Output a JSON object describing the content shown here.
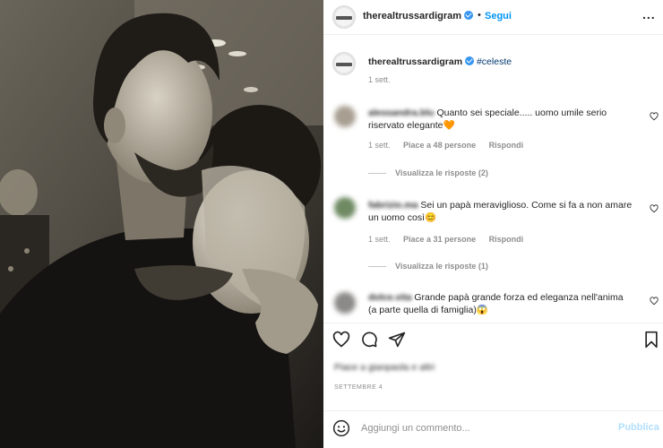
{
  "post": {
    "username": "therealtrussardigram",
    "follow_label": "Segui",
    "dot": "•",
    "more_label": "...",
    "caption_hashtag": "#celeste",
    "caption_time": "1 sett."
  },
  "comments": [
    {
      "username": "alessandra.blu",
      "text_line1": "Quanto sei speciale..... uomo umile serio",
      "text_line2": "riservato elegante",
      "emoji": "🧡",
      "time": "1 sett.",
      "likes": "Piace a 48 persone",
      "reply_label": "Rispondi",
      "view_replies": "Visualizza le risposte (2)"
    },
    {
      "username": "fabrizio.ma",
      "text_line1": "Sei un papà meraviglioso. Come si fa a non amare",
      "text_line2": "un uomo così",
      "emoji": "😊",
      "time": "1 sett.",
      "likes": "Piace a 31 persone",
      "reply_label": "Rispondi",
      "view_replies": "Visualizza le risposte (1)"
    },
    {
      "username": "dolce.vita",
      "text_line1": "Grande papà grande forza ed eleganza nell'anima",
      "text_line2": "(a parte quella di famiglia)",
      "emoji": "😱"
    }
  ],
  "likes_summary": "Piace a gianpaola e altri",
  "post_date": "Settembre 4",
  "add_comment": {
    "placeholder": "Aggiungi un commento...",
    "publish_label": "Pubblica"
  },
  "icons": [
    "heart-outline-icon",
    "comment-icon",
    "share-icon",
    "bookmark-icon",
    "emoji-icon",
    "more-options-icon",
    "verified-badge-icon"
  ],
  "colors": {
    "link_blue": "#0095f6",
    "hashtag": "#00376b",
    "secondary_text": "#8e8e8e",
    "verified": "#3897f0",
    "publish_disabled": "#b2dffc"
  }
}
